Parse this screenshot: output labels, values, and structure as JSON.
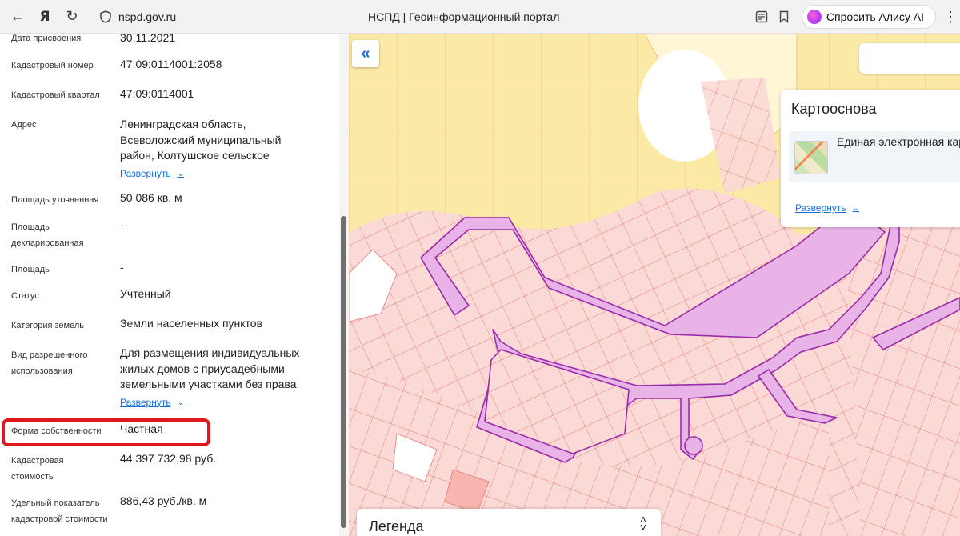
{
  "browser": {
    "url": "nspd.gov.ru",
    "tab_title": "НСПД | Геоинформационный портал",
    "alice_label": "Спросить Алису AI"
  },
  "details": {
    "rows": [
      {
        "label": "Дата присвоения",
        "value": "30.11.2021"
      },
      {
        "label": "Кадастровый номер",
        "value": "47:09:0114001:2058"
      },
      {
        "label": "Кадастровый квартал",
        "value": "47:09:0114001"
      },
      {
        "label": "Адрес",
        "value": "Ленинградская область, Всеволожский муниципальный район, Колтушское сельское",
        "expand": "Развернуть"
      },
      {
        "label": "Площадь уточненная",
        "value": "50 086 кв. м"
      },
      {
        "label": "Площадь декларированная",
        "value": "-"
      },
      {
        "label": "Площадь",
        "value": "-"
      },
      {
        "label": "Статус",
        "value": "Учтенный"
      },
      {
        "label": "Категория земель",
        "value": "Земли населенных пунктов"
      },
      {
        "label": "Вид разрешенного использования",
        "value": "Для размещения индивидуальных жилых домов с приусадебными земельными участками без права",
        "expand": "Развернуть"
      },
      {
        "label": "Форма собственности",
        "value": "Частная"
      },
      {
        "label": "Кадастровая стоимость",
        "value": "44 397 732,98 руб."
      },
      {
        "label": "Удельный показатель кадастровой стоимости",
        "value": "886,43 руб./кв. м"
      }
    ]
  },
  "map": {
    "basemap": {
      "title": "Картооснова",
      "layer_name": "Единая электронная картографическая осн (основной слой)",
      "expand": "Развернуть"
    },
    "legend_label": "Легенда"
  }
}
